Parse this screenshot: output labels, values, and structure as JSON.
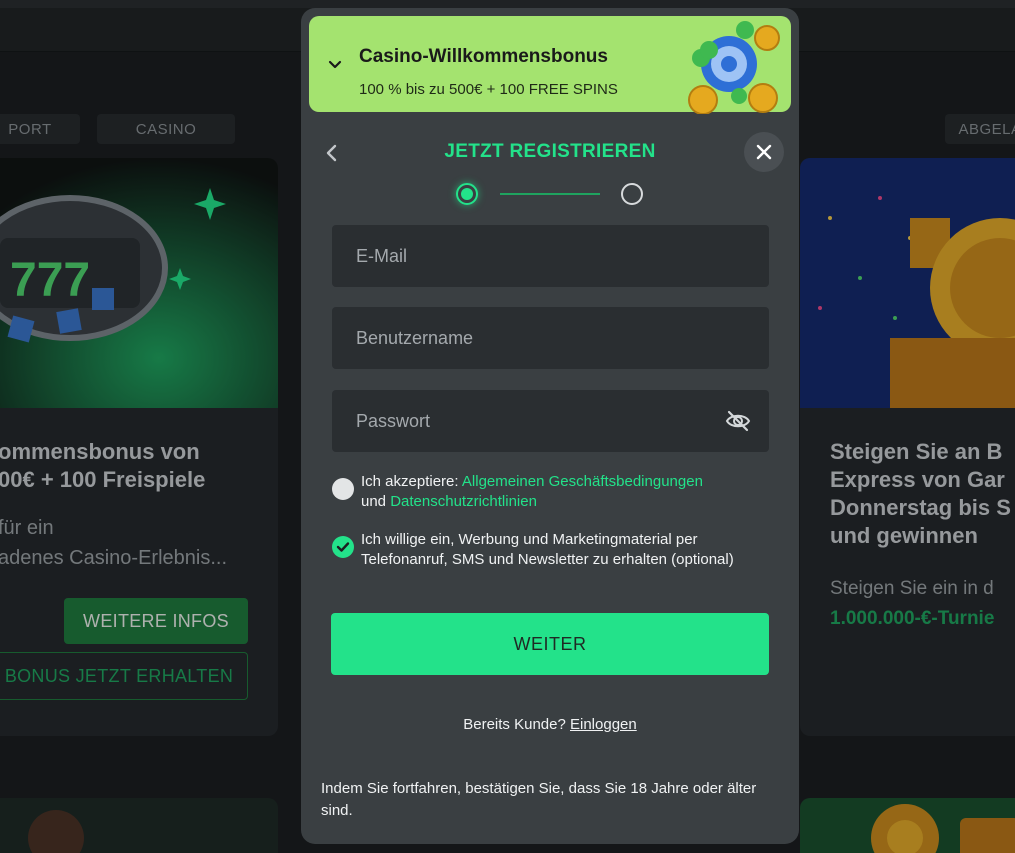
{
  "background": {
    "tabs": [
      "PORT",
      "CASINO",
      "ABGELA"
    ],
    "left_card": {
      "title_lines": [
        "ommensbonus von",
        "00€ + 100 Freispiele"
      ],
      "desc_lines": [
        "für ein",
        "adenes Casino-Erlebnis..."
      ],
      "more_button": "WEITERE INFOS",
      "bonus_button": "BONUS JETZT ERHALTEN"
    },
    "right_card": {
      "title_lines": [
        "Steigen Sie an B",
        "Express von Gar",
        "Donnerstag bis S",
        "und gewinnen"
      ],
      "desc_line": "Steigen Sie ein in d",
      "highlight": "1.000.000-€-Turnie"
    }
  },
  "modal": {
    "bonus": {
      "title": "Casino-Willkommensbonus",
      "subtitle": "100 % bis zu 500€ + 100 FREE SPINS"
    },
    "title": "JETZT REGISTRIEREN",
    "fields": {
      "email_placeholder": "E-Mail",
      "username_placeholder": "Benutzername",
      "password_placeholder": "Passwort"
    },
    "terms": {
      "prefix": "Ich akzeptiere: ",
      "agb_link": "Allgemeinen Geschäftsbedingungen",
      "and": "und ",
      "privacy_link": "Datenschutzrichtlinien"
    },
    "marketing": "Ich willige ein, Werbung und Marketingmaterial per Telefonanruf, SMS und Newsletter zu erhalten (optional)",
    "submit": "WEITER",
    "login_prompt": "Bereits Kunde? ",
    "login_link": "Einloggen",
    "age_note": "Indem Sie fortfahren, bestätigen Sie, dass Sie 18 Jahre oder älter sind."
  }
}
